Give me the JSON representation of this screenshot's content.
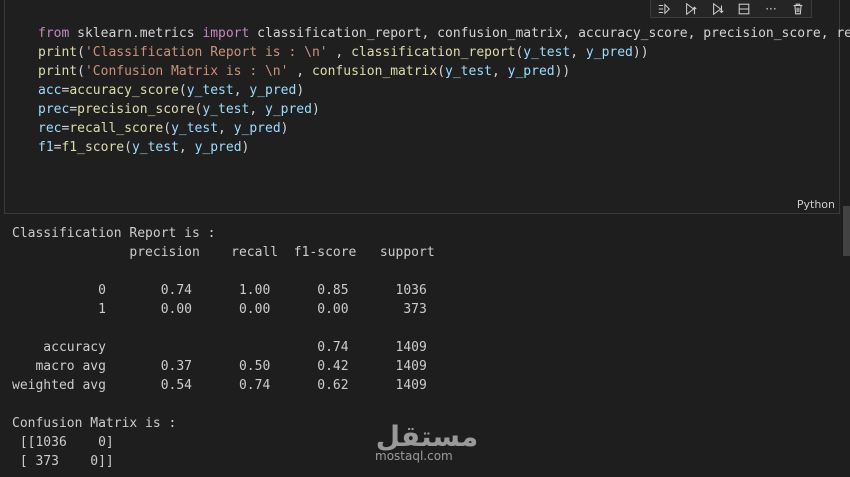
{
  "toolbar": {
    "icons": [
      "run-by-line-icon",
      "execute-above-icon",
      "execute-below-icon",
      "split-cell-icon",
      "more-actions-icon",
      "delete-cell-icon"
    ],
    "more_label": "···"
  },
  "cell": {
    "language": "Python",
    "code_lines": [
      [
        {
          "t": "from",
          "c": "kw"
        },
        {
          "t": " sklearn.metrics ",
          "c": "plain"
        },
        {
          "t": "import",
          "c": "kw"
        },
        {
          "t": " classification_report, confusion_matrix, accuracy_score, precision_score, rec",
          "c": "plain"
        }
      ],
      [
        {
          "t": "print",
          "c": "fn"
        },
        {
          "t": "(",
          "c": "plain"
        },
        {
          "t": "'Classification Report is : \\n'",
          "c": "str"
        },
        {
          "t": " , ",
          "c": "plain"
        },
        {
          "t": "classification_report",
          "c": "fn"
        },
        {
          "t": "(",
          "c": "plain"
        },
        {
          "t": "y_test",
          "c": "var"
        },
        {
          "t": ", ",
          "c": "plain"
        },
        {
          "t": "y_pred",
          "c": "var"
        },
        {
          "t": "))",
          "c": "plain"
        }
      ],
      [
        {
          "t": "print",
          "c": "fn"
        },
        {
          "t": "(",
          "c": "plain"
        },
        {
          "t": "'Confusion Matrix is : \\n'",
          "c": "str"
        },
        {
          "t": " , ",
          "c": "plain"
        },
        {
          "t": "confusion_matrix",
          "c": "fn"
        },
        {
          "t": "(",
          "c": "plain"
        },
        {
          "t": "y_test",
          "c": "var"
        },
        {
          "t": ", ",
          "c": "plain"
        },
        {
          "t": "y_pred",
          "c": "var"
        },
        {
          "t": "))",
          "c": "plain"
        }
      ],
      [
        {
          "t": "acc",
          "c": "var"
        },
        {
          "t": "=",
          "c": "plain"
        },
        {
          "t": "accuracy_score",
          "c": "fn"
        },
        {
          "t": "(",
          "c": "plain"
        },
        {
          "t": "y_test",
          "c": "var"
        },
        {
          "t": ", ",
          "c": "plain"
        },
        {
          "t": "y_pred",
          "c": "var"
        },
        {
          "t": ")",
          "c": "plain"
        }
      ],
      [
        {
          "t": "prec",
          "c": "var"
        },
        {
          "t": "=",
          "c": "plain"
        },
        {
          "t": "precision_score",
          "c": "fn"
        },
        {
          "t": "(",
          "c": "plain"
        },
        {
          "t": "y_test",
          "c": "var"
        },
        {
          "t": ", ",
          "c": "plain"
        },
        {
          "t": "y_pred",
          "c": "var"
        },
        {
          "t": ")",
          "c": "plain"
        }
      ],
      [
        {
          "t": "rec",
          "c": "var"
        },
        {
          "t": "=",
          "c": "plain"
        },
        {
          "t": "recall_score",
          "c": "fn"
        },
        {
          "t": "(",
          "c": "plain"
        },
        {
          "t": "y_test",
          "c": "var"
        },
        {
          "t": ", ",
          "c": "plain"
        },
        {
          "t": "y_pred",
          "c": "var"
        },
        {
          "t": ")",
          "c": "plain"
        }
      ],
      [
        {
          "t": "f1",
          "c": "var"
        },
        {
          "t": "=",
          "c": "plain"
        },
        {
          "t": "f1_score",
          "c": "fn"
        },
        {
          "t": "(",
          "c": "plain"
        },
        {
          "t": "y_test",
          "c": "var"
        },
        {
          "t": ", ",
          "c": "plain"
        },
        {
          "t": "y_pred",
          "c": "var"
        },
        {
          "t": ")",
          "c": "plain"
        }
      ]
    ]
  },
  "output": {
    "lines": [
      "Classification Report is :",
      "               precision    recall  f1-score   support",
      "",
      "           0       0.74      1.00      0.85      1036",
      "           1       0.00      0.00      0.00       373",
      "",
      "    accuracy                           0.74      1409",
      "   macro avg       0.37      0.50      0.42      1409",
      "weighted avg       0.54      0.74      0.62      1409",
      "",
      "Confusion Matrix is :",
      " [[1036    0]",
      " [ 373    0]]"
    ]
  },
  "watermark": {
    "logo_text": "مستقل",
    "site": "mostaql.com"
  }
}
